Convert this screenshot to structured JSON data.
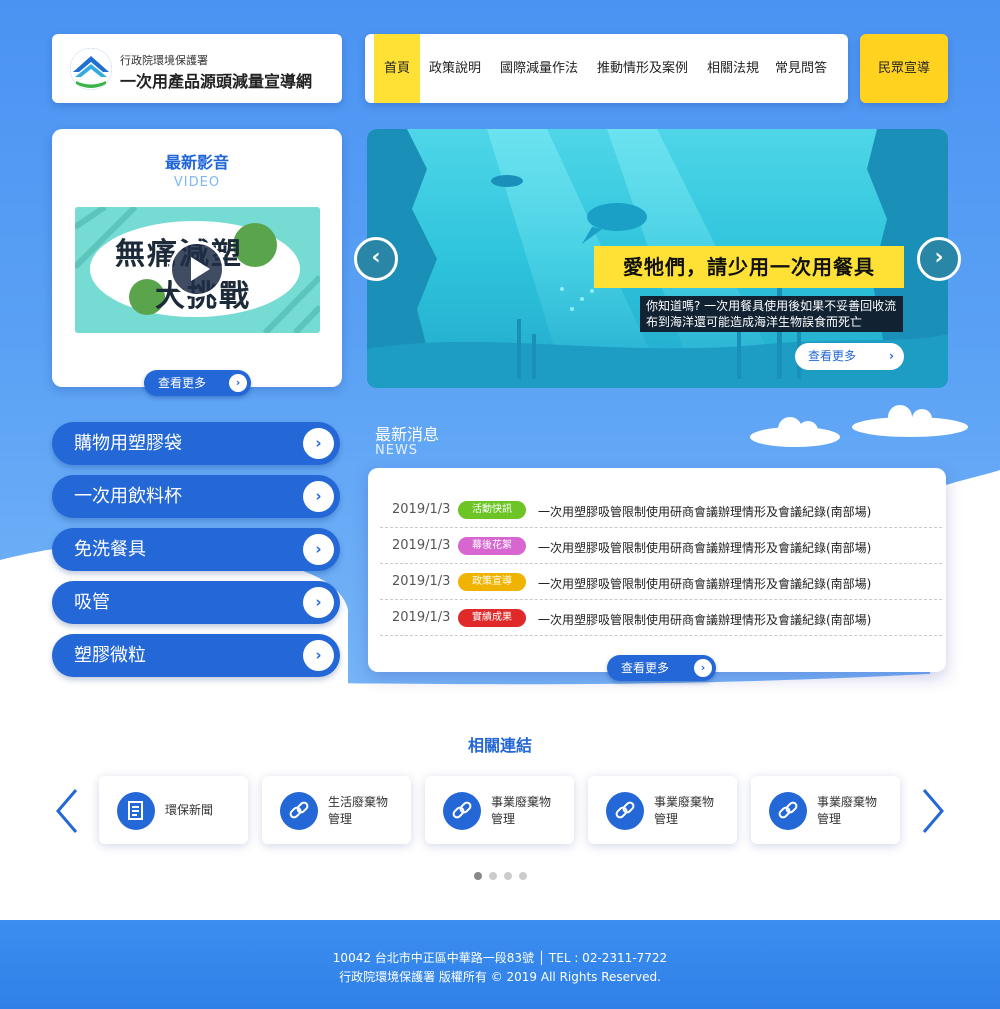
{
  "colors": {
    "primary": "#2467d6",
    "accent_yellow": "#ffe135",
    "sky": "#4b93f2"
  },
  "header": {
    "org_name": "行政院環境保護署",
    "site_name": "一次用產品源頭減量宣導網",
    "nav": [
      "首頁",
      "政策說明",
      "國際減量作法",
      "推動情形及案例",
      "相關法規",
      "常見問答"
    ],
    "cta_label": "民眾宣導"
  },
  "video": {
    "title": "最新影音",
    "subtitle": "VIDEO",
    "thumb_text_1": "無痛減塑",
    "thumb_text_2": "大挑戰",
    "more_label": "查看更多"
  },
  "banner": {
    "headline": "愛牠們，請少用一次用餐具",
    "subline": "你知道嗎? 一次用餐具使用後如果不妥善回收流布到海洋還可能造成海洋生物誤食而死亡",
    "more_label": "查看更多"
  },
  "categories": [
    "購物用塑膠袋",
    "一次用飲料杯",
    "免洗餐具",
    "吸管",
    "塑膠微粒"
  ],
  "news": {
    "title": "最新消息",
    "subtitle": "NEWS",
    "items": [
      {
        "date": "2019/1/3",
        "tag": "活動快訊",
        "tag_color": "#6cc425",
        "text": "一次用塑膠吸管限制使用研商會議辦理情形及會議紀錄(南部場)"
      },
      {
        "date": "2019/1/3",
        "tag": "幕後花絮",
        "tag_color": "#d766d1",
        "text": "一次用塑膠吸管限制使用研商會議辦理情形及會議紀錄(南部場)"
      },
      {
        "date": "2019/1/3",
        "tag": "政策宣導",
        "tag_color": "#f0b400",
        "text": "一次用塑膠吸管限制使用研商會議辦理情形及會議紀錄(南部場)"
      },
      {
        "date": "2019/1/3",
        "tag": "實績成果",
        "tag_color": "#e02a2a",
        "text": "一次用塑膠吸管限制使用研商會議辦理情形及會議紀錄(南部場)"
      }
    ],
    "more_label": "查看更多"
  },
  "links": {
    "title": "相關連結",
    "items": [
      {
        "line1": "環保新聞",
        "line2": "",
        "icon": "news-icon"
      },
      {
        "line1": "生活廢棄物",
        "line2": "管理",
        "icon": "link-icon"
      },
      {
        "line1": "事業廢棄物",
        "line2": "管理",
        "icon": "link-icon"
      },
      {
        "line1": "事業廢棄物",
        "line2": "管理",
        "icon": "link-icon"
      },
      {
        "line1": "事業廢棄物",
        "line2": "管理",
        "icon": "link-icon"
      }
    ]
  },
  "footer": {
    "address": "10042 台北市中正區中華路一段83號 │ TEL : 02-2311-7722",
    "copyright": "行政院環境保護署 版權所有 © 2019 All Rights Reserved."
  }
}
